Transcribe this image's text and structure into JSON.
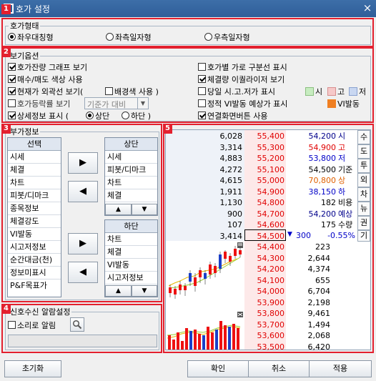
{
  "window": {
    "title": "호가 설정",
    "close": "×"
  },
  "badges": [
    "1",
    "2",
    "3",
    "4",
    "5"
  ],
  "quote_type": {
    "legend": "호가형태",
    "options": [
      {
        "label": "좌우대칭형",
        "selected": true
      },
      {
        "label": "좌측일자형",
        "selected": false
      },
      {
        "label": "우측일자형",
        "selected": false
      }
    ]
  },
  "options": {
    "legend": "보기옵션",
    "left": [
      {
        "label": "호가잔량 그래프 보기",
        "checked": true
      },
      {
        "label": "매수/매도 색상 사용",
        "checked": true
      },
      {
        "label": "현재가 외곽선 보기(",
        "checked": true,
        "sub_label": "배경색 사용 )",
        "sub_checked": false
      },
      {
        "label": "호가등락률 보기",
        "checked": false,
        "dropdown": "기준가 대비"
      },
      {
        "label": "상세정보 표시 (",
        "checked": true,
        "radio_a": "상단",
        "radio_b": "하단 )"
      }
    ],
    "right": [
      {
        "label": "호가별 가로 구분선 표시",
        "checked": false
      },
      {
        "label": "체결량 이퀄라이저 보기",
        "checked": true
      },
      {
        "label": "당일 시.고.저가 표시",
        "checked": false,
        "legend": [
          "시",
          "고",
          "저"
        ]
      },
      {
        "label": "정적 VI발동 예상가 표시",
        "checked": false,
        "legend": [
          "VI발동"
        ]
      },
      {
        "label": "연결화면버튼 사용",
        "checked": true
      }
    ],
    "colors": {
      "open": "#c7ecc0",
      "high": "#f6c9c9",
      "low": "#c9d7f1",
      "vi": "#f07f22"
    }
  },
  "additional_info": {
    "legend": "부가정보",
    "selection_header": "선택",
    "selection": [
      "시세",
      "체결",
      "차트",
      "피봇/디마크",
      "종목정보",
      "체결강도",
      "VI발동",
      "시고저정보",
      "순간대금(천)",
      "정보미표시",
      "P&F목표가"
    ],
    "top_header": "상단",
    "top": [
      "시세",
      "피봇/디마크",
      "차트",
      "체결"
    ],
    "bottom_header": "하단",
    "bottom": [
      "차트",
      "체결",
      "VI발동",
      "시고저정보"
    ],
    "arrows": {
      "right": "▶",
      "left": "◀",
      "up": "▲",
      "down": "▼"
    }
  },
  "signal": {
    "legend": "신호수신 알람설정",
    "sound_label": "소리로 알림",
    "sound_checked": false
  },
  "preview": {
    "ask": [
      {
        "qty": "6,028",
        "price": "55,400"
      },
      {
        "qty": "3,314",
        "price": "55,300"
      },
      {
        "qty": "4,883",
        "price": "55,200"
      },
      {
        "qty": "4,272",
        "price": "55,100"
      },
      {
        "qty": "4,615",
        "price": "55,000"
      },
      {
        "qty": "1,911",
        "price": "54,900"
      },
      {
        "qty": "1,130",
        "price": "54,800"
      },
      {
        "qty": "900",
        "price": "54,700"
      },
      {
        "qty": "107",
        "price": "54,600"
      },
      {
        "qty": "3,414",
        "price": "54,500"
      }
    ],
    "bid": [
      {
        "price": "54,400",
        "qty": "223"
      },
      {
        "price": "54,300",
        "qty": "2,644"
      },
      {
        "price": "54,200",
        "qty": "4,374"
      },
      {
        "price": "54,100",
        "qty": "655"
      },
      {
        "price": "54,000",
        "qty": "6,704"
      },
      {
        "price": "53,900",
        "qty": "2,198"
      },
      {
        "price": "53,800",
        "qty": "9,461"
      },
      {
        "price": "53,700",
        "qty": "1,494"
      },
      {
        "price": "53,600",
        "qty": "2,068"
      },
      {
        "price": "53,500",
        "qty": "6,420"
      }
    ],
    "info": [
      {
        "value": "54,200",
        "label": "시",
        "color": "#00008b"
      },
      {
        "value": "54,900",
        "label": "고",
        "color": "#e00000"
      },
      {
        "value": "53,800",
        "label": "저",
        "color": "#0000c8"
      },
      {
        "value": "54,500",
        "label": "기준",
        "color": "#000000"
      },
      {
        "value": "70,800",
        "label": "상",
        "color": "#e06000"
      },
      {
        "value": "38,150",
        "label": "하",
        "color": "#0000c8"
      },
      {
        "value": "182",
        "label": "비용",
        "color": "#000000"
      },
      {
        "value": "54,200",
        "label": "예상",
        "color": "#00008b"
      },
      {
        "value": "175",
        "label": "수량",
        "color": "#000000"
      }
    ],
    "change": {
      "arrow": "▼",
      "diff": "300",
      "rate": "-0.55%"
    },
    "side_tabs": [
      "수",
      "도",
      "투",
      "외",
      "차",
      "뉴",
      "권",
      "기"
    ]
  },
  "footer": {
    "reset": "초기화",
    "ok": "확인",
    "cancel": "취소",
    "apply": "적용"
  }
}
